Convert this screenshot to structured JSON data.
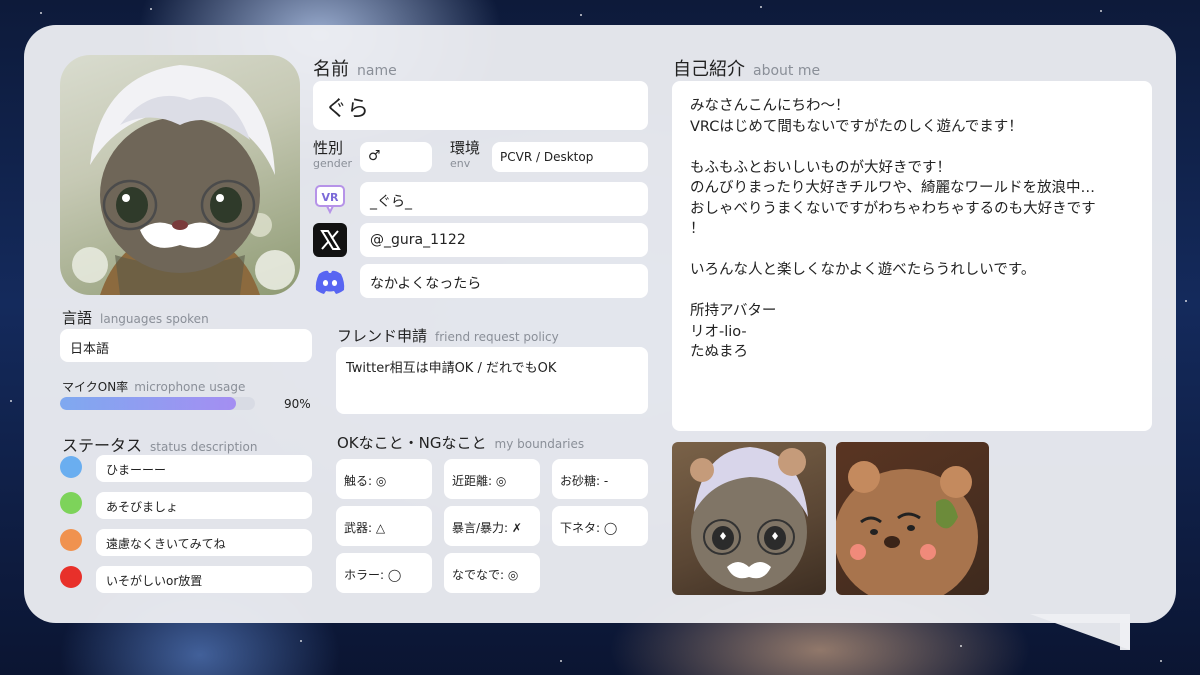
{
  "profile": {
    "name_label_jp": "名前",
    "name_label_en": "name",
    "name": "ぐら",
    "gender_label_jp": "性別",
    "gender_label_en": "gender",
    "gender": "♂",
    "env_label_jp": "環境",
    "env_label_en": "env",
    "env": "PCVR / Desktop",
    "vrchat": "_ぐら_",
    "twitter": "@_gura_1122",
    "discord": "なかよくなったら"
  },
  "languages": {
    "label_jp": "言語",
    "label_en": "languages spoken",
    "value": "日本語"
  },
  "mic": {
    "label_jp": "マイクON率",
    "label_en": "microphone usage",
    "percent": 90,
    "percent_text": "90%"
  },
  "status": {
    "label_jp": "ステータス",
    "label_en": "status description",
    "items": [
      {
        "color": "#6aaef0",
        "text": "ひまーーー"
      },
      {
        "color": "#7dd35a",
        "text": "あそびましょ"
      },
      {
        "color": "#f0924f",
        "text": "遠慮なくきいてみてね"
      },
      {
        "color": "#e8302a",
        "text": "いそがしいor放置"
      }
    ]
  },
  "friend": {
    "label_jp": "フレンド申請",
    "label_en": "friend request policy",
    "value": "Twitter相互は申請OK / だれでもOK"
  },
  "boundaries": {
    "label_jp": "OKなこと・NGなこと",
    "label_en": "my boundaries",
    "items": [
      "触る: ◎",
      "近距離: ◎",
      "お砂糖: -",
      "武器: △",
      "暴言/暴力: ✗",
      "下ネタ: ◯",
      "ホラー: ◯",
      "なでなで: ◎"
    ]
  },
  "about": {
    "label_jp": "自己紹介",
    "label_en": "about me",
    "text": "みなさんこんにちわ～！\nVRCはじめて間もないですがたのしく遊んでます！\n\nもふもふとおいしいものが大好きです！\nのんびりまったり大好きチルワや、綺麗なワールドを放浪中…\nおしゃべりうまくないですがわちゃわちゃするのも大好きです\n！\n\nいろんな人と楽しくなかよく遊べたらうれしいです。\n\n所持アバター\nリオ-lio-\nたぬまろ"
  },
  "icons": {
    "vrchat": "vrchat-icon",
    "twitter": "x-twitter-icon",
    "discord": "discord-icon"
  }
}
